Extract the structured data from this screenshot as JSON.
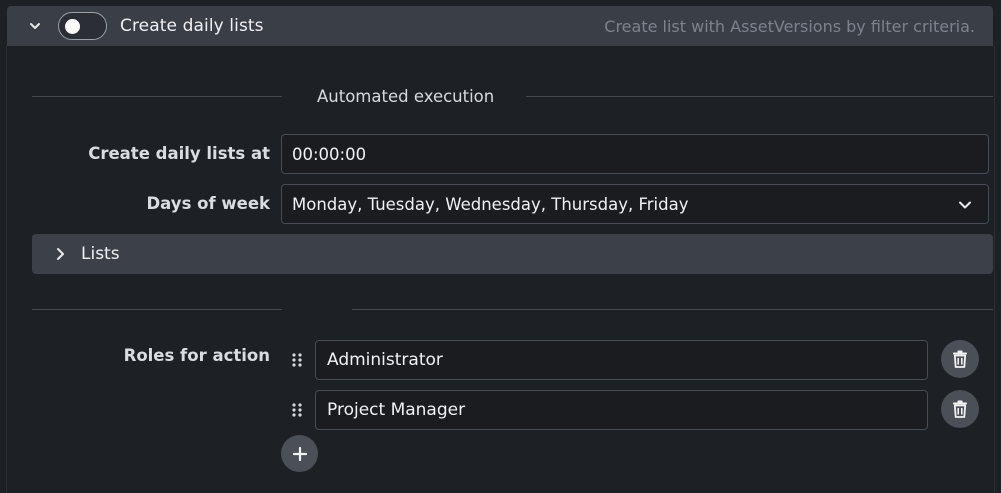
{
  "header": {
    "title": "Create daily lists",
    "description": "Create list with AssetVersions by filter criteria.",
    "toggle_on": false,
    "expand_icon": "chevron-down-icon"
  },
  "automated_execution": {
    "section_label": "Automated execution",
    "time_label": "Create daily lists at",
    "time_value": "00:00:00",
    "days_label": "Days of week",
    "days_value": "Monday, Tuesday, Wednesday, Thursday, Friday",
    "days_icon": "chevron-down-icon"
  },
  "lists": {
    "label": "Lists",
    "icon": "chevron-right-icon"
  },
  "roles": {
    "label": "Roles for action",
    "items": [
      {
        "value": "Administrator"
      },
      {
        "value": "Project Manager"
      }
    ],
    "delete_icon": "trash-icon",
    "drag_icon": "drag-handle-icon",
    "add_icon": "plus-icon"
  },
  "colors": {
    "header_bg": "#3a3e46",
    "panel_bg": "#1d2024",
    "field_bg": "#1a1c20",
    "button_bg": "#4a4f58",
    "muted_text": "#7d838d"
  }
}
